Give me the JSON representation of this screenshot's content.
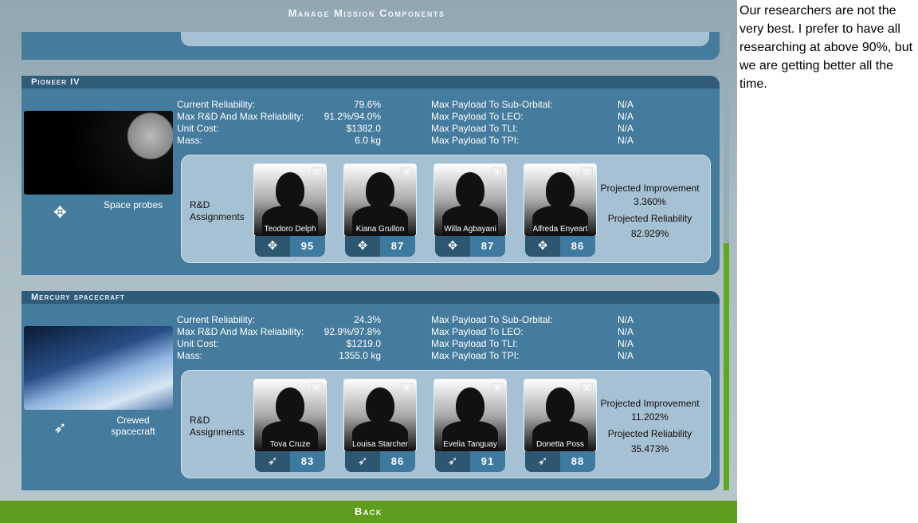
{
  "title": "Manage Mission Components",
  "back_label": "Back",
  "rd_label": "R&D Assignments",
  "labels": {
    "current_reliability": "Current Reliability:",
    "max_rd": "Max R&D And Max Reliability:",
    "unit_cost": "Unit Cost:",
    "mass": "Mass:",
    "sub_orbital": "Max Payload To Sub-Orbital:",
    "leo": "Max Payload To LEO:",
    "tli": "Max Payload To TLI:",
    "tpi": "Max Payload To TPI:",
    "proj_improvement": "Projected Improvement",
    "proj_reliability": "Projected Reliability"
  },
  "components": [
    {
      "name": "Pioneer IV",
      "category": "Space probes",
      "category_icon": "satellite-icon",
      "current_reliability": "79.6%",
      "max_rd": "91.2%/94.0%",
      "unit_cost": "$1382.0",
      "mass": "6.0 kg",
      "sub_orbital": "N/A",
      "leo": "N/A",
      "tli": "N/A",
      "tpi": "N/A",
      "proj_improvement": "3.360%",
      "proj_reliability": "82.929%",
      "researchers": [
        {
          "name": "Teodoro Delph",
          "skill": "95"
        },
        {
          "name": "Kiana Grullon",
          "skill": "87"
        },
        {
          "name": "Willa Agbayani",
          "skill": "87"
        },
        {
          "name": "Alfreda Enyeart",
          "skill": "86"
        }
      ]
    },
    {
      "name": "Mercury spacecraft",
      "category": "Crewed spacecraft",
      "category_icon": "capsule-icon",
      "current_reliability": "24.3%",
      "max_rd": "92.9%/97.8%",
      "unit_cost": "$1219.0",
      "mass": "1355.0 kg",
      "sub_orbital": "N/A",
      "leo": "N/A",
      "tli": "N/A",
      "tpi": "N/A",
      "proj_improvement": "11.202%",
      "proj_reliability": "35.473%",
      "researchers": [
        {
          "name": "Tova Cruze",
          "skill": "83"
        },
        {
          "name": "Louisa Starcher",
          "skill": "86"
        },
        {
          "name": "Evelia Tanguay",
          "skill": "91"
        },
        {
          "name": "Donetta Poss",
          "skill": "88"
        }
      ]
    }
  ],
  "remove_label": "X",
  "note": "Our researchers are not the very best. I prefer to have all researching at above 90%, but we are getting better all the time."
}
